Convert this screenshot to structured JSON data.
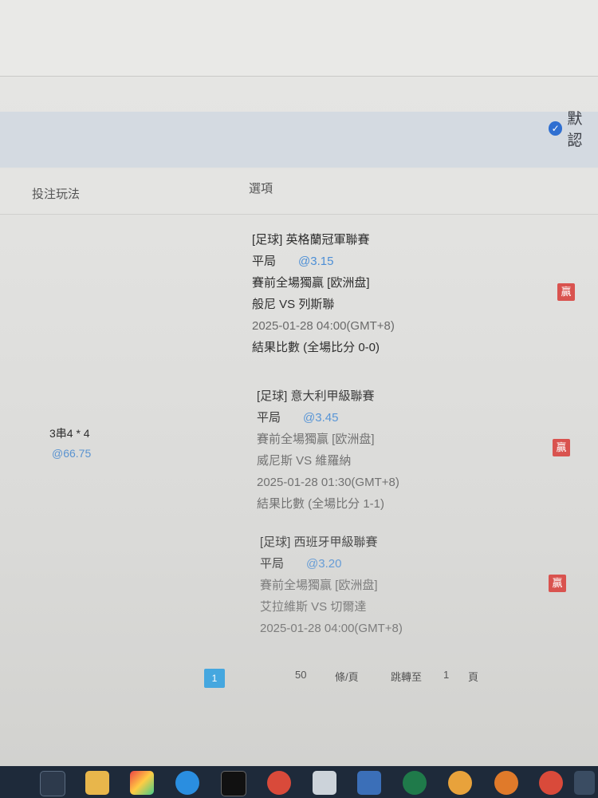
{
  "filter": {
    "default_label": "默認"
  },
  "table": {
    "headers": {
      "play_type": "投注玩法",
      "options": "選項"
    }
  },
  "bet": {
    "type": "3串4 * 4",
    "total_odds": "@66.75"
  },
  "matches": [
    {
      "league": "[足球] 英格蘭冠軍聯賽",
      "pick": "平局",
      "odds": "@3.15",
      "market": "賽前全場獨贏 [欧洲盘]",
      "teams": "般尼 VS 列斯聯",
      "time": "2025-01-28 04:00(GMT+8)",
      "result": "結果比數 (全場比分 0-0)",
      "status": "贏"
    },
    {
      "league": "[足球] 意大利甲級聯賽",
      "pick": "平局",
      "odds": "@3.45",
      "market": "賽前全場獨贏 [欧洲盘]",
      "teams": "威尼斯 VS 維羅納",
      "time": "2025-01-28 01:30(GMT+8)",
      "result": "結果比數 (全場比分 1-1)",
      "status": "贏"
    },
    {
      "league": "[足球] 西班牙甲級聯賽",
      "pick": "平局",
      "odds": "@3.20",
      "market": "賽前全場獨贏 [欧洲盘]",
      "teams": "艾拉維斯 VS 切爾達",
      "time": "2025-01-28 04:00(GMT+8)",
      "status": "贏"
    }
  ],
  "pagination": {
    "current_page": "1",
    "page_size": "50",
    "per_page_unit": "條/頁",
    "jump_label": "跳轉至",
    "jump_value": "1",
    "page_unit": "頁"
  },
  "colors": {
    "accent": "#45a7df",
    "win": "#d9534f",
    "odds": "#4d8fd6"
  }
}
